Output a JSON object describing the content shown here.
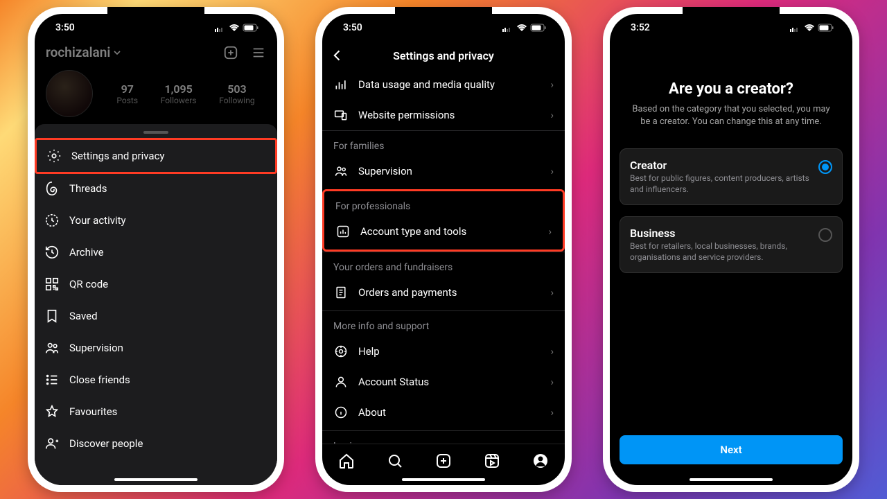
{
  "phone1": {
    "time": "3:50",
    "username": "rochizalani",
    "stats": {
      "posts_n": "97",
      "posts_l": "Posts",
      "followers_n": "1,095",
      "followers_l": "Followers",
      "following_n": "503",
      "following_l": "Following"
    },
    "menu": {
      "settings": "Settings and privacy",
      "threads": "Threads",
      "activity": "Your activity",
      "archive": "Archive",
      "qr": "QR code",
      "saved": "Saved",
      "supervision": "Supervision",
      "close": "Close friends",
      "fav": "Favourites",
      "discover": "Discover people"
    }
  },
  "phone2": {
    "time": "3:50",
    "title": "Settings and privacy",
    "rows": {
      "data_usage": "Data usage and media quality",
      "website": "Website permissions"
    },
    "sec_families": "For families",
    "supervision": "Supervision",
    "sec_prof": "For professionals",
    "account_type": "Account type and tools",
    "sec_orders": "Your orders and fundraisers",
    "orders": "Orders and payments",
    "sec_more": "More info and support",
    "help": "Help",
    "status": "Account Status",
    "about": "About",
    "sec_login": "Login"
  },
  "phone3": {
    "time": "3:52",
    "title": "Are you a creator?",
    "sub": "Based on the category that you selected, you may be a creator. You can change this at any time.",
    "creator_t": "Creator",
    "creator_d": "Best for public figures, content producers, artists and influencers.",
    "business_t": "Business",
    "business_d": "Best for retailers, local businesses, brands, organisations and service providers.",
    "next": "Next"
  }
}
